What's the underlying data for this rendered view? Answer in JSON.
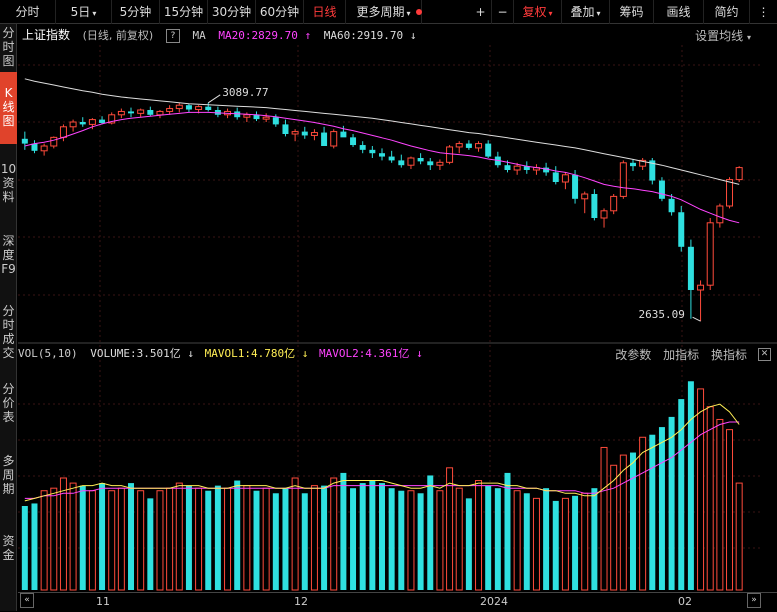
{
  "toolbar": {
    "tabs": [
      {
        "label": "分时"
      },
      {
        "label": "5日",
        "dropdown": true
      },
      {
        "label": "5分钟"
      },
      {
        "label": "15分钟"
      },
      {
        "label": "30分钟"
      },
      {
        "label": "60分钟"
      },
      {
        "label": "日线",
        "active": true
      },
      {
        "label": "更多周期",
        "dropdown": true
      }
    ],
    "zoom_in": "+",
    "zoom_out": "−",
    "fuquan": "复权",
    "diejia": "叠加",
    "chouma": "筹码",
    "huaxian": "画线",
    "jianyue": "简约",
    "sandian": "⋮"
  },
  "sidebar": {
    "items": [
      "分时图",
      "K线图",
      "10资料",
      "深度F9",
      "分时成交",
      "分价表",
      "多周期",
      "资金"
    ]
  },
  "price_panel": {
    "index_name": "上证指数",
    "sub": "(日线, 前复权)",
    "help": "?",
    "ma_label": "MA",
    "ma20": "MA20:2829.70",
    "ma60": "MA60:2919.70",
    "settings": "设置均线",
    "high_label": "3089.77",
    "low_label": "2635.09"
  },
  "volume_panel": {
    "label": "VOL(5,10)",
    "volume": "VOLUME:3.501亿",
    "mavol1": "MAVOL1:4.780亿",
    "mavol2": "MAVOL2:4.361亿",
    "btn_params": "改参数",
    "btn_add": "加指标",
    "btn_switch": "换指标",
    "close": "✕"
  },
  "xaxis": {
    "labels": [
      "11",
      "12",
      "2024",
      "02"
    ]
  },
  "colors": {
    "up": "#ff4b3b",
    "down": "#2fe0e0",
    "ma20": "#ff44ff",
    "ma60": "#dddddd",
    "mavol1": "#ffee55",
    "mavol2": "#ff44ff"
  },
  "chart_data": {
    "type": "candlestick",
    "candles": [
      [
        3015,
        3030,
        2992,
        3005,
        0
      ],
      [
        3005,
        3012,
        2985,
        2990,
        0
      ],
      [
        2990,
        3005,
        2980,
        3000,
        1
      ],
      [
        3000,
        3020,
        2995,
        3018,
        1
      ],
      [
        3018,
        3045,
        3010,
        3040,
        1
      ],
      [
        3040,
        3055,
        3030,
        3050,
        1
      ],
      [
        3050,
        3060,
        3040,
        3045,
        0
      ],
      [
        3045,
        3058,
        3035,
        3055,
        1
      ],
      [
        3055,
        3062,
        3045,
        3048,
        0
      ],
      [
        3048,
        3070,
        3045,
        3065,
        1
      ],
      [
        3065,
        3078,
        3058,
        3072,
        1
      ],
      [
        3072,
        3080,
        3060,
        3068,
        0
      ],
      [
        3068,
        3078,
        3060,
        3075,
        1
      ],
      [
        3075,
        3082,
        3062,
        3065,
        0
      ],
      [
        3065,
        3075,
        3058,
        3072,
        1
      ],
      [
        3072,
        3085,
        3065,
        3078,
        1
      ],
      [
        3078,
        3089.77,
        3070,
        3085,
        1
      ],
      [
        3085,
        3088,
        3070,
        3076,
        0
      ],
      [
        3076,
        3085,
        3068,
        3082,
        1
      ],
      [
        3082,
        3090,
        3072,
        3075,
        0
      ],
      [
        3075,
        3082,
        3060,
        3065,
        0
      ],
      [
        3065,
        3078,
        3058,
        3072,
        1
      ],
      [
        3072,
        3080,
        3055,
        3060,
        0
      ],
      [
        3060,
        3070,
        3050,
        3065,
        1
      ],
      [
        3065,
        3072,
        3052,
        3056,
        0
      ],
      [
        3056,
        3068,
        3050,
        3060,
        1
      ],
      [
        3060,
        3066,
        3040,
        3045,
        0
      ],
      [
        3045,
        3055,
        3020,
        3025,
        0
      ],
      [
        3025,
        3035,
        3010,
        3030,
        1
      ],
      [
        3030,
        3040,
        3015,
        3022,
        0
      ],
      [
        3022,
        3035,
        3012,
        3028,
        1
      ],
      [
        3028,
        3040,
        3020,
        3000,
        0
      ],
      [
        3000,
        3035,
        2995,
        3030,
        1
      ],
      [
        3030,
        3042,
        3022,
        3018,
        0
      ],
      [
        3018,
        3025,
        2998,
        3002,
        0
      ],
      [
        3002,
        3010,
        2985,
        2992,
        0
      ],
      [
        2992,
        3000,
        2975,
        2985,
        0
      ],
      [
        2985,
        2995,
        2970,
        2978,
        0
      ],
      [
        2978,
        2990,
        2965,
        2970,
        0
      ],
      [
        2970,
        2982,
        2955,
        2960,
        0
      ],
      [
        2960,
        2978,
        2952,
        2975,
        1
      ],
      [
        2975,
        2985,
        2962,
        2968,
        0
      ],
      [
        2968,
        2975,
        2950,
        2960,
        0
      ],
      [
        2960,
        2972,
        2950,
        2966,
        1
      ],
      [
        2966,
        3002,
        2962,
        2998,
        1
      ],
      [
        2998,
        3010,
        2985,
        3005,
        1
      ],
      [
        3005,
        3012,
        2992,
        2996,
        0
      ],
      [
        2996,
        3010,
        2988,
        3005,
        1
      ],
      [
        3005,
        3012,
        2975,
        2978,
        0
      ],
      [
        2978,
        2988,
        2955,
        2960,
        0
      ],
      [
        2960,
        2970,
        2945,
        2950,
        0
      ],
      [
        2950,
        2965,
        2940,
        2958,
        1
      ],
      [
        2958,
        2968,
        2942,
        2950,
        0
      ],
      [
        2950,
        2962,
        2940,
        2955,
        1
      ],
      [
        2955,
        2965,
        2938,
        2945,
        0
      ],
      [
        2945,
        2958,
        2920,
        2925,
        0
      ],
      [
        2925,
        2945,
        2910,
        2940,
        1
      ],
      [
        2940,
        2950,
        2880,
        2890,
        0
      ],
      [
        2890,
        2905,
        2860,
        2900,
        1
      ],
      [
        2900,
        2910,
        2845,
        2850,
        0
      ],
      [
        2850,
        2870,
        2830,
        2865,
        1
      ],
      [
        2865,
        2900,
        2858,
        2895,
        1
      ],
      [
        2895,
        2970,
        2890,
        2965,
        1
      ],
      [
        2965,
        2972,
        2948,
        2958,
        0
      ],
      [
        2958,
        2975,
        2950,
        2970,
        1
      ],
      [
        2970,
        2975,
        2920,
        2928,
        0
      ],
      [
        2928,
        2935,
        2885,
        2890,
        0
      ],
      [
        2890,
        2900,
        2855,
        2862,
        0
      ],
      [
        2862,
        2875,
        2780,
        2790,
        0
      ],
      [
        2790,
        2805,
        2640,
        2700,
        0
      ],
      [
        2700,
        2720,
        2635.09,
        2710,
        1
      ],
      [
        2710,
        2850,
        2700,
        2840,
        1
      ],
      [
        2840,
        2880,
        2830,
        2875,
        1
      ],
      [
        2875,
        2935,
        2870,
        2930,
        1
      ],
      [
        2930,
        2958,
        2925,
        2955,
        1
      ]
    ],
    "ma20": [
      3000,
      3005,
      3008,
      3012,
      3018,
      3025,
      3032,
      3040,
      3046,
      3051,
      3055,
      3058,
      3060,
      3062,
      3064,
      3066,
      3068,
      3070,
      3070,
      3070,
      3069,
      3068,
      3067,
      3066,
      3065,
      3063,
      3061,
      3058,
      3055,
      3052,
      3049,
      3045,
      3041,
      3036,
      3032,
      3027,
      3022,
      3017,
      3012,
      3006,
      3000,
      2995,
      2990,
      2986,
      2984,
      2982,
      2980,
      2977,
      2973,
      2970,
      2966,
      2962,
      2958,
      2955,
      2952,
      2948,
      2945,
      2940,
      2934,
      2927,
      2920,
      2916,
      2913,
      2911,
      2908,
      2905,
      2900,
      2895,
      2888,
      2878,
      2868,
      2860,
      2852,
      2845,
      2840
    ],
    "ma60": [
      3140,
      3135,
      3131,
      3127,
      3123,
      3119,
      3115,
      3112,
      3108,
      3105,
      3102,
      3100,
      3098,
      3096,
      3094,
      3092,
      3090,
      3088,
      3087,
      3086,
      3085,
      3084,
      3083,
      3082,
      3081,
      3080,
      3078,
      3076,
      3074,
      3072,
      3070,
      3068,
      3066,
      3064,
      3062,
      3060,
      3058,
      3055,
      3052,
      3049,
      3046,
      3043,
      3040,
      3037,
      3034,
      3031,
      3028,
      3026,
      3023,
      3020,
      3017,
      3014,
      3011,
      3008,
      3005,
      3002,
      2999,
      2996,
      2992,
      2988,
      2984,
      2980,
      2976,
      2972,
      2968,
      2964,
      2960,
      2955,
      2950,
      2945,
      2940,
      2935,
      2930,
      2925,
      2920
    ],
    "volume": [
      3.3,
      3.4,
      3.9,
      4.0,
      4.4,
      4.2,
      4.1,
      3.9,
      4.2,
      3.9,
      4.0,
      4.2,
      3.9,
      3.6,
      3.9,
      4.0,
      4.2,
      4.1,
      4.0,
      3.9,
      4.1,
      4.0,
      4.3,
      4.1,
      3.9,
      4.0,
      3.8,
      4.0,
      4.4,
      3.8,
      4.1,
      4.1,
      4.4,
      4.6,
      4.0,
      4.2,
      4.3,
      4.2,
      4.0,
      3.9,
      3.9,
      3.8,
      4.5,
      3.9,
      4.8,
      4.0,
      3.6,
      4.3,
      4.1,
      4.0,
      4.6,
      3.9,
      3.8,
      3.6,
      4.0,
      3.5,
      3.6,
      3.7,
      3.8,
      4.0,
      5.6,
      4.9,
      5.3,
      5.4,
      6.0,
      6.1,
      6.4,
      6.8,
      7.5,
      8.2,
      7.9,
      7.2,
      6.7,
      6.3,
      4.2
    ],
    "mavol1": [
      3.5,
      3.6,
      3.7,
      3.8,
      3.9,
      4.0,
      4.1,
      4.1,
      4.2,
      4.1,
      4.1,
      4.0,
      4.0,
      4.0,
      4.0,
      4.0,
      4.1,
      4.1,
      4.1,
      4.0,
      4.0,
      4.0,
      4.1,
      4.1,
      4.1,
      4.1,
      4.0,
      4.0,
      4.1,
      4.0,
      4.0,
      4.0,
      4.2,
      4.3,
      4.3,
      4.3,
      4.3,
      4.3,
      4.2,
      4.1,
      4.0,
      4.0,
      4.1,
      4.0,
      4.2,
      4.1,
      4.1,
      4.2,
      4.2,
      4.2,
      4.1,
      4.1,
      4.0,
      4.0,
      3.9,
      3.9,
      3.8,
      3.8,
      3.7,
      3.7,
      4.0,
      4.3,
      4.7,
      5.0,
      5.4,
      5.6,
      5.8,
      6.0,
      6.3,
      6.7,
      7.0,
      7.2,
      7.3,
      7.0,
      6.5
    ],
    "mavol2": [
      3.6,
      3.6,
      3.7,
      3.7,
      3.8,
      3.8,
      3.9,
      3.9,
      4.0,
      4.0,
      4.0,
      4.0,
      4.0,
      4.0,
      4.0,
      4.0,
      4.0,
      4.0,
      4.0,
      4.0,
      4.0,
      4.0,
      4.0,
      4.0,
      4.0,
      4.0,
      4.0,
      4.0,
      4.0,
      4.0,
      4.0,
      4.0,
      4.1,
      4.1,
      4.1,
      4.1,
      4.1,
      4.1,
      4.1,
      4.1,
      4.1,
      4.1,
      4.1,
      4.1,
      4.1,
      4.1,
      4.1,
      4.1,
      4.1,
      4.1,
      4.0,
      4.0,
      4.0,
      4.0,
      3.9,
      3.9,
      3.9,
      3.9,
      3.8,
      3.8,
      3.9,
      4.0,
      4.2,
      4.4,
      4.6,
      4.8,
      5.0,
      5.2,
      5.5,
      5.8,
      6.1,
      6.3,
      6.5,
      6.6,
      6.6
    ],
    "price_range": [
      2600,
      3200
    ],
    "volume_range": [
      0,
      8.8
    ]
  }
}
